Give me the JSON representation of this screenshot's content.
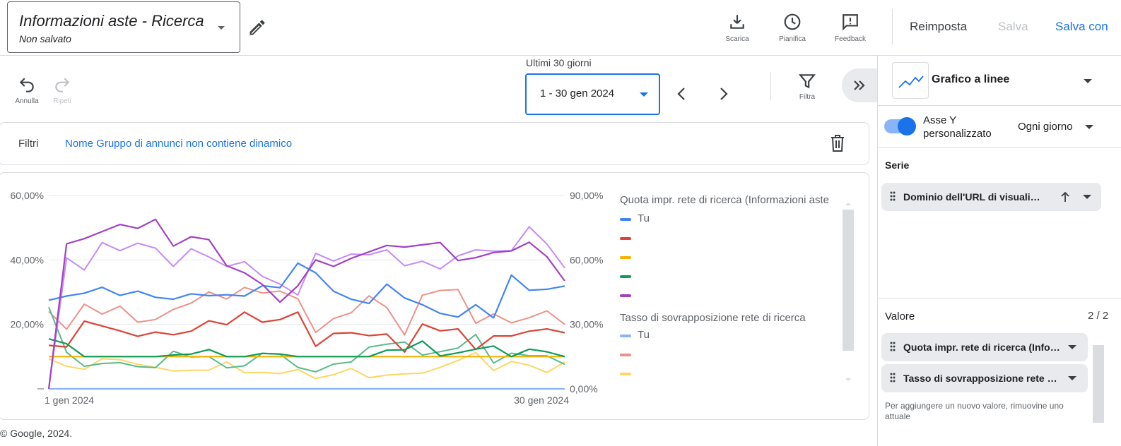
{
  "header": {
    "title": "Informazioni aste - Ricerca",
    "subtitle": "Non salvato",
    "tools": [
      {
        "label": "Scarica",
        "icon": "download-icon"
      },
      {
        "label": "Pianifica",
        "icon": "clock-icon"
      },
      {
        "label": "Feedback",
        "icon": "feedback-icon"
      }
    ],
    "reset_label": "Reimposta",
    "save_label": "Salva",
    "save_as_label": "Salva con"
  },
  "toolbar": {
    "undo_label": "Annulla",
    "redo_label": "Ripeti",
    "range_caption": "Ultimi 30 giorni",
    "range_value": "1 - 30 gen 2024",
    "filter_label": "Filtra"
  },
  "filters": {
    "label": "Filtri",
    "value": "Nome Gruppo di annunci non contiene dinamico"
  },
  "footer": {
    "copyright": "© Google, 2024."
  },
  "legend": {
    "group1_title": "Quota impr. rete di ricerca (Informazioni aste",
    "group1_items": [
      {
        "label": "Tu",
        "color": "#4285f4"
      },
      {
        "label": "",
        "color": "#db4437"
      },
      {
        "label": "",
        "color": "#f4b400"
      },
      {
        "label": "",
        "color": "#0f9d58"
      },
      {
        "label": "",
        "color": "#a142c3"
      }
    ],
    "group2_title": "Tasso di sovrapposizione rete di ricerca",
    "group2_items": [
      {
        "label": "Tu",
        "color": "#8ab4f8"
      },
      {
        "label": "",
        "color": "#ee9188"
      },
      {
        "label": "",
        "color": "#fdd663"
      }
    ]
  },
  "panel": {
    "chart_type": "Grafico a linee",
    "y_axis_label_1": "Asse Y",
    "y_axis_label_2": "personalizzato",
    "frequency": "Ogni giorno",
    "series_title": "Serie",
    "series_chip": "Dominio dell'URL di visualizzazione",
    "value_title": "Valore",
    "value_count": "2 / 2",
    "value_chips": [
      "Quota impr. rete di ricerca (Informazioni aste)",
      "Tasso di sovrapposizione rete di ricerca"
    ],
    "hint": "Per aggiungere un nuovo valore, rimuovine uno attuale"
  },
  "chart_data": {
    "type": "line",
    "x_labels": [
      "1 gen 2024",
      "30 gen 2024"
    ],
    "x": [
      1,
      2,
      3,
      4,
      5,
      6,
      7,
      8,
      9,
      10,
      11,
      12,
      13,
      14,
      15,
      16,
      17,
      18,
      19,
      20,
      21,
      22,
      23,
      24,
      25,
      26,
      27,
      28,
      29,
      30
    ],
    "y_left": {
      "ticks": [
        "",
        "20,00%",
        "40,00%",
        "60,00%"
      ],
      "range": [
        0,
        60
      ]
    },
    "y_right": {
      "ticks": [
        "0,00%",
        "30,00%",
        "60,00%",
        "90,00%"
      ],
      "range": [
        0,
        90
      ]
    },
    "series": [
      {
        "name": "Tu",
        "group": "Quota impr. rete di ricerca",
        "axis": "left",
        "color": "#4285f4",
        "width": 2.2,
        "values": [
          27.5,
          28.8,
          29.7,
          31.5,
          29.0,
          30.3,
          28.4,
          27.8,
          29.5,
          28.9,
          29.2,
          28.8,
          32.0,
          31.4,
          39.0,
          36.0,
          30.3,
          27.8,
          26.5,
          32.5,
          28.2,
          26.1,
          23.4,
          22.3,
          26.1,
          22.0,
          35.3,
          30.6,
          30.9,
          31.9
        ]
      },
      {
        "name": "",
        "group": "Quota impr. rete di ricerca",
        "axis": "left",
        "color": "#db4437",
        "width": 2.2,
        "values": [
          13.5,
          13.0,
          21.0,
          19.5,
          18.0,
          16.3,
          17.6,
          16.8,
          17.9,
          21.1,
          19.9,
          23.8,
          20.7,
          21.5,
          23.8,
          13.2,
          17.2,
          17.4,
          16.5,
          17.0,
          11.4,
          20.1,
          18.0,
          18.6,
          12.2,
          16.4,
          16.4,
          17.9,
          18.6,
          17.4
        ]
      },
      {
        "name": "",
        "group": "Quota impr. rete di ricerca",
        "axis": "left",
        "color": "#f4b400",
        "width": 2.2,
        "values": [
          10,
          10,
          10,
          10,
          10,
          10,
          10,
          10,
          10,
          10,
          10,
          10,
          10,
          10,
          10,
          10,
          10,
          10,
          10,
          10,
          10,
          10,
          10,
          10,
          10,
          10,
          10,
          10,
          10,
          10
        ]
      },
      {
        "name": "",
        "group": "Quota impr. rete di ricerca",
        "axis": "left",
        "color": "#0f9d58",
        "width": 2.2,
        "values": [
          15.5,
          14.0,
          10.0,
          10.0,
          10.0,
          10.0,
          10.0,
          10.5,
          10.8,
          12.2,
          10.0,
          10.0,
          11.0,
          10.8,
          10.0,
          10.0,
          10.0,
          10.0,
          10.0,
          12.0,
          12.1,
          14.8,
          10.2,
          11.2,
          12.3,
          13.3,
          10.0,
          12.3,
          11.5,
          10.0
        ]
      },
      {
        "name": "",
        "group": "Quota impr. rete di ricerca",
        "axis": "left",
        "color": "#a142c3",
        "width": 2.2,
        "values": [
          0,
          45.0,
          46.6,
          48.8,
          51.0,
          49.8,
          52.6,
          44.3,
          47.2,
          46.3,
          38.2,
          36.0,
          32.4,
          26.9,
          32.0,
          40.0,
          38.0,
          40.5,
          42.5,
          44.5,
          44.0,
          44.7,
          45.4,
          39.8,
          40.7,
          42.3,
          42.8,
          45.5,
          41.0,
          33.5
        ]
      },
      {
        "name": "Tu",
        "group": "Tasso di sovrapposizione rete di ricerca",
        "axis": "right",
        "color": "#8ab4f8",
        "width": 2.2,
        "values": [
          0,
          0,
          0,
          0,
          0,
          0,
          0,
          0,
          0,
          0,
          0,
          0,
          0,
          0,
          0,
          0,
          0,
          0,
          0,
          0,
          0,
          0,
          0,
          0,
          0,
          0,
          0,
          0,
          0,
          0
        ]
      },
      {
        "name": "",
        "group": "Tasso di sovrapposizione rete di ricerca",
        "axis": "right",
        "color": "#ee9188",
        "width": 2,
        "values": [
          36.0,
          27.8,
          39.4,
          34.8,
          38.5,
          31.0,
          32.3,
          37.0,
          39.9,
          45.1,
          41.8,
          47.2,
          44.6,
          45.5,
          41.9,
          26.2,
          32.7,
          35.4,
          43.3,
          37.8,
          25.1,
          43.6,
          45.8,
          46.2,
          30.5,
          34.9,
          30.7,
          33.1,
          36.3,
          30.0
        ]
      },
      {
        "name": "",
        "group": "Tasso di sovrapposizione rete di ricerca",
        "axis": "right",
        "color": "#fdd663",
        "width": 2,
        "values": [
          14.0,
          10.5,
          9.1,
          14.0,
          13.6,
          11.4,
          10.0,
          8.3,
          8.6,
          8.7,
          12.5,
          7.5,
          7.7,
          7.1,
          9.0,
          4.8,
          6.6,
          9.5,
          5.2,
          6.4,
          7.0,
          7.3,
          10.0,
          13.2,
          16.9,
          8.5,
          12.7,
          11.0,
          7.6,
          12.5
        ]
      },
      {
        "name": "",
        "group": "Tasso di sovrapposizione rete di ricerca",
        "axis": "right",
        "color": "#57bb8a",
        "width": 2,
        "values": [
          38.0,
          17.0,
          10.5,
          11.8,
          12.2,
          10.3,
          9.9,
          17.5,
          14.8,
          15.0,
          9.8,
          10.7,
          16.6,
          16.1,
          10.0,
          7.9,
          11.5,
          12.5,
          19.4,
          20.8,
          21.8,
          15.7,
          17.3,
          19.0,
          25.3,
          12.0,
          16.6,
          15.4,
          15.4,
          11.4
        ]
      },
      {
        "name": "",
        "group": "Tasso di sovrapposizione rete di ricerca",
        "axis": "right",
        "color": "#c58af9",
        "width": 2,
        "values": [
          0,
          61.0,
          55.3,
          68.1,
          64.3,
          67.8,
          65.5,
          57.0,
          65.2,
          61.4,
          57.0,
          59.2,
          52.4,
          48.7,
          43.7,
          63.1,
          59.5,
          62.7,
          62.4,
          64.7,
          57.3,
          59.4,
          55.8,
          61.9,
          64.7,
          64.1,
          64.3,
          75.4,
          67.4,
          56.3
        ]
      }
    ]
  }
}
